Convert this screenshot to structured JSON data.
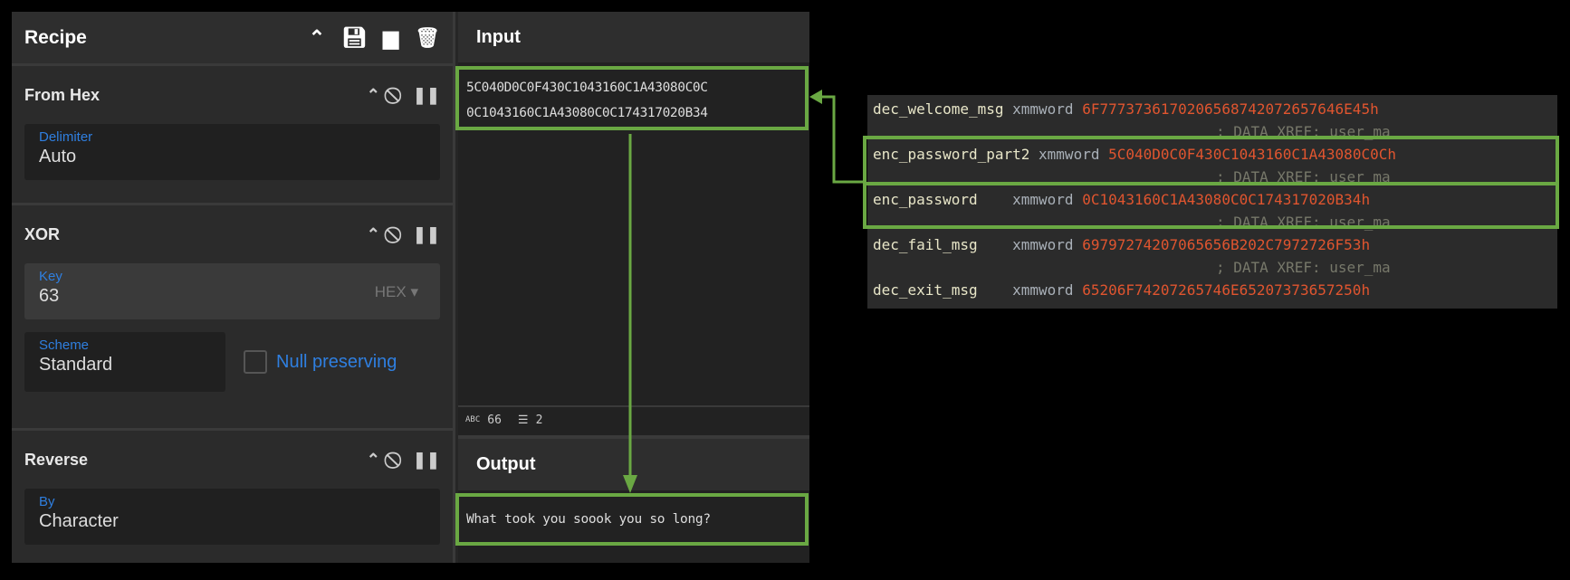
{
  "recipe": {
    "title": "Recipe",
    "icons": [
      "chevron-up-icon",
      "save-icon",
      "folder-icon",
      "trash-icon"
    ],
    "operations": [
      {
        "name": "From Hex",
        "fields": [
          {
            "label": "Delimiter",
            "value": "Auto"
          }
        ]
      },
      {
        "name": "XOR",
        "key_label": "Key",
        "key_value": "63",
        "key_format": "HEX",
        "scheme_label": "Scheme",
        "scheme_value": "Standard",
        "null_preserving_label": "Null preserving",
        "null_preserving": false
      },
      {
        "name": "Reverse",
        "fields": [
          {
            "label": "By",
            "value": "Character"
          }
        ]
      }
    ]
  },
  "input": {
    "title": "Input",
    "lines": [
      "5C040D0C0F430C1043160C1A43080C0C",
      "0C1043160C1A43080C0C174317020B34"
    ],
    "length": "66",
    "lines_count": "2"
  },
  "output": {
    "title": "Output",
    "text": "What took you soook you so long?"
  },
  "disasm": {
    "rows": [
      {
        "name": "dec_welcome_msg ",
        "type": "xmmword ",
        "value": "6F7773736170206568742072657646E45h"
      },
      {
        "comment": "; DATA XREF: user_ma"
      },
      {
        "name": "enc_password_part2 ",
        "type": "xmmword ",
        "value": "5C040D0C0F430C1043160C1A43080C0Ch"
      },
      {
        "comment": "; DATA XREF: user_ma"
      },
      {
        "name": "enc_password    ",
        "type": "xmmword ",
        "value": "0C1043160C1A43080C0C174317020B34h"
      },
      {
        "comment": "; DATA XREF: user_ma"
      },
      {
        "name": "dec_fail_msg    ",
        "type": "xmmword ",
        "value": "69797274207065656B202C7972726F53h"
      },
      {
        "comment": "; DATA XREF: user_ma"
      },
      {
        "name": "dec_exit_msg    ",
        "type": "xmmword ",
        "value": "65206F74207265746E65207373657250h"
      }
    ]
  },
  "colors": {
    "highlight": "#6aa843",
    "hex_value": "#e0552f",
    "label_blue": "#2f7fe0"
  }
}
